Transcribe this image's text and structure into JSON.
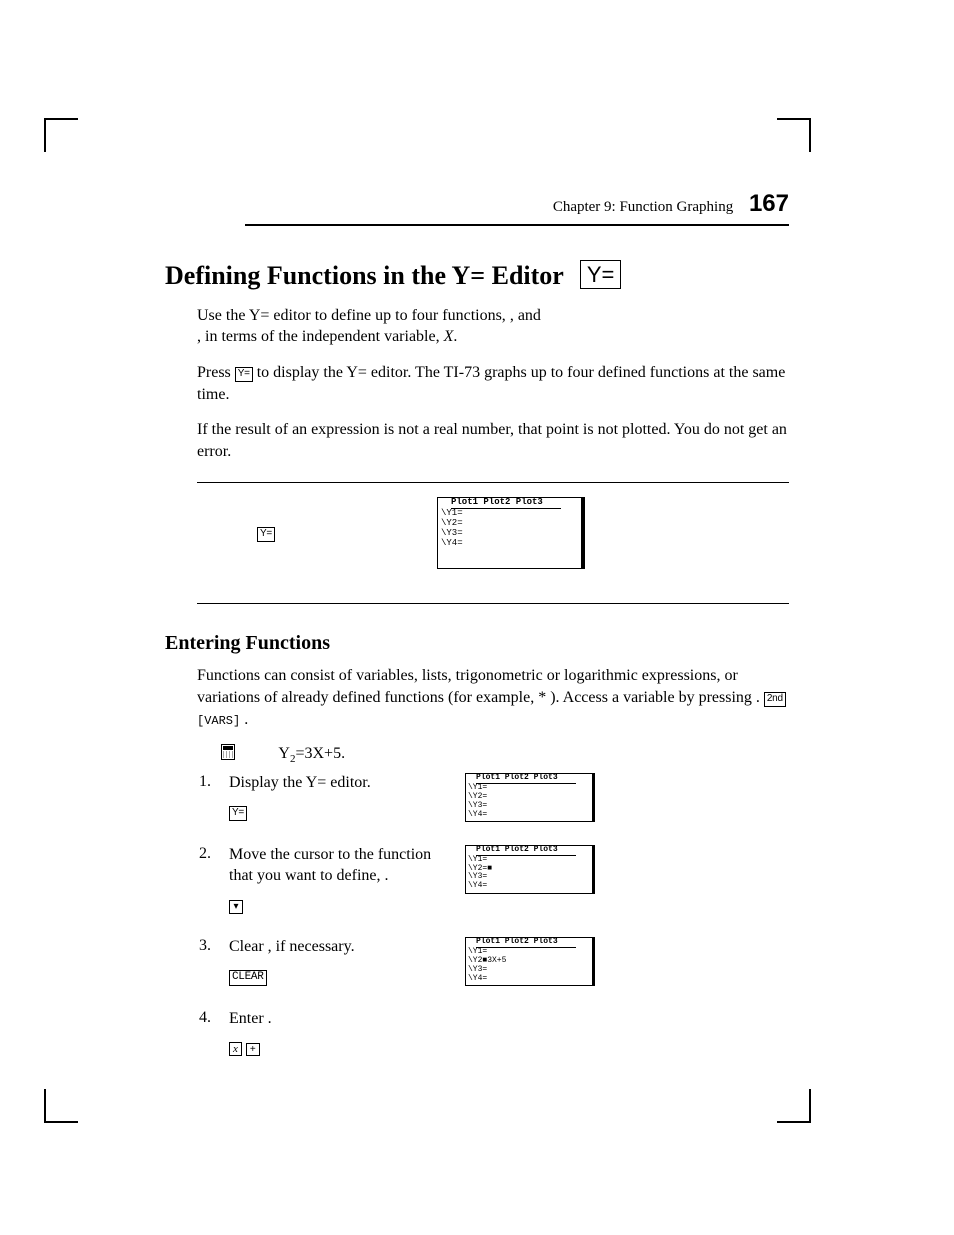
{
  "header": {
    "chapter_label": "Chapter 9: Function Graphing",
    "page_number": "167"
  },
  "h1": {
    "text": "Defining Functions in the Y= Editor",
    "keycap": "Y="
  },
  "intro": {
    "p1a": "Use the Y= editor to define up to four functions,",
    "p1b": ", and",
    "p1c": ", in terms of the independent variable, ",
    "p1d": "X",
    "p1e": ".",
    "p2a": "Press ",
    "p2key": "Y=",
    "p2b": " to display the Y= editor. The TI-73 graphs up to four defined functions at the same time.",
    "p3": "If the result of an expression is not a real number, that point is not plotted. You do not get an error."
  },
  "example1": {
    "key": "Y=",
    "plots_line": "Plot1 Plot2 Plot3",
    "lines": "\\Y1=\n\\Y2=\n\\Y3=\n\\Y4="
  },
  "h2": "Entering Functions",
  "entering": {
    "p1a": "Functions can consist of variables, lists, trigonometric or logarithmic expressions, or variations of already defined functions (for example, ",
    "p1b": " * ",
    "p1c": "). Access a ",
    "p1d": " variable by pressing ",
    "p1key1": "2nd",
    "p1key2": "[VARS]",
    "p1e": "."
  },
  "define_label": "Y",
  "define_sub": "2",
  "define_rest": "=3X+5.",
  "steps": [
    {
      "num": "1.",
      "text": "Display the Y= editor.",
      "keys_html": "Y=",
      "screen_plots": "Plot1 Plot2 Plot3",
      "screen_lines": "\\Y1=\n\\Y2=\n\\Y3=\n\\Y4="
    },
    {
      "num": "2.",
      "text": "Move the cursor to the function that you want to define, .",
      "keys_arrow": "▾",
      "screen_plots": "Plot1 Plot2 Plot3",
      "screen_lines": "\\Y1=\n\\Y2=■\n\\Y3=\n\\Y4="
    },
    {
      "num": "3.",
      "text": "Clear  , if necessary.",
      "keys_clear": "CLEAR",
      "screen_plots": "Plot1 Plot2 Plot3",
      "screen_lines": "\\Y1=\n\\Y2■3X+5\n\\Y3=\n\\Y4="
    },
    {
      "num": "4.",
      "text": "Enter        .",
      "keys_x": "x",
      "keys_plus": "+"
    }
  ]
}
